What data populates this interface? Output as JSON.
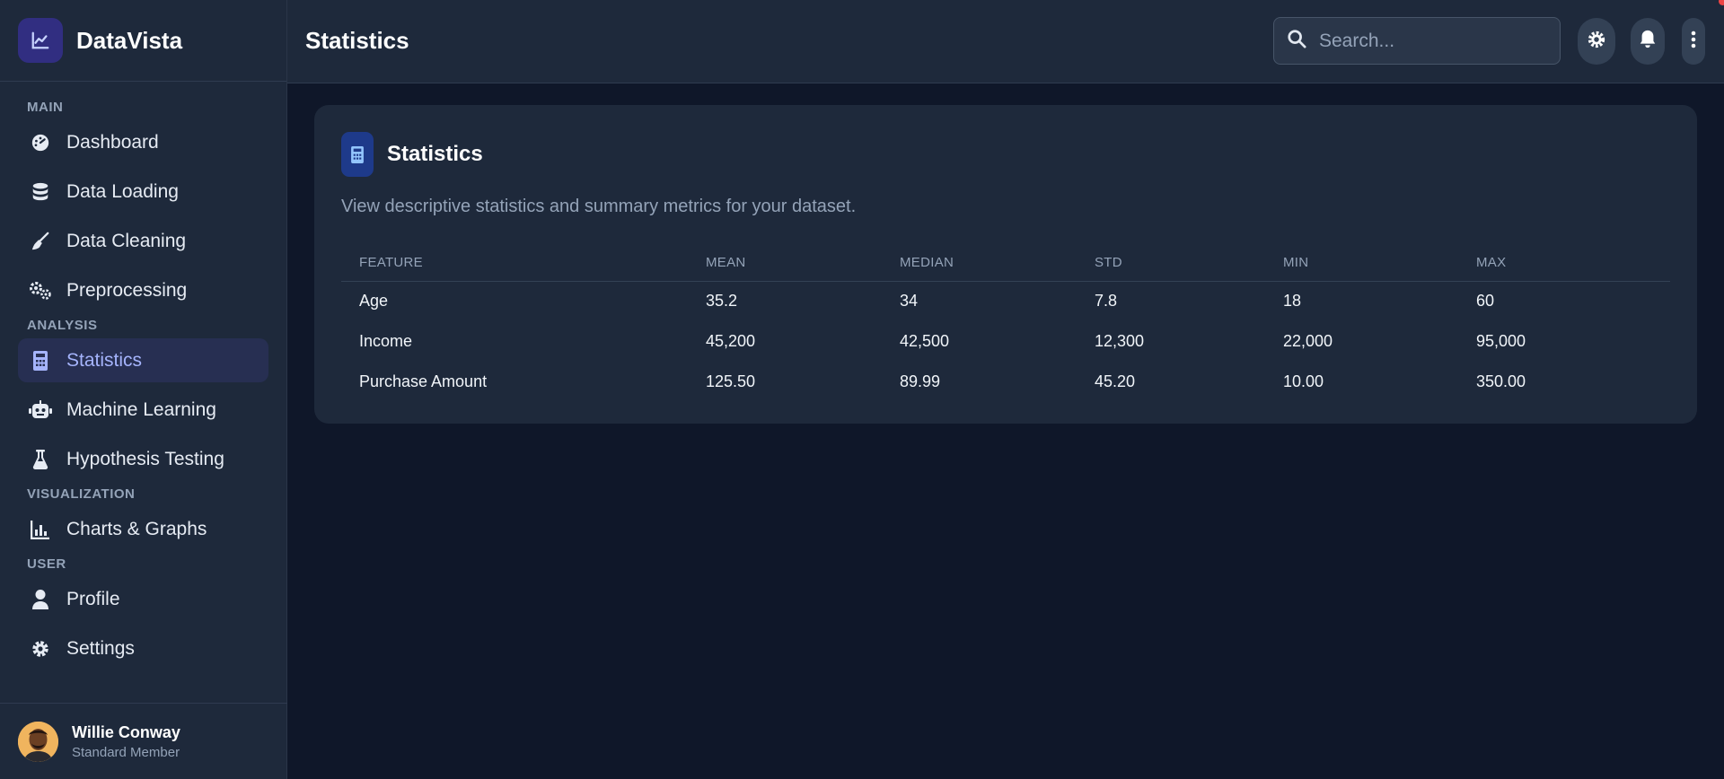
{
  "brand": {
    "name": "DataVista",
    "icon": "chart-line-icon",
    "accent": "#312e81"
  },
  "sidebar": {
    "sections": [
      {
        "label": "MAIN",
        "items": [
          {
            "label": "Dashboard",
            "icon": "gauge-icon"
          },
          {
            "label": "Data Loading",
            "icon": "database-icon"
          },
          {
            "label": "Data Cleaning",
            "icon": "broom-icon"
          },
          {
            "label": "Preprocessing",
            "icon": "gears-icon"
          }
        ]
      },
      {
        "label": "ANALYSIS",
        "items": [
          {
            "label": "Statistics",
            "icon": "calculator-icon",
            "active": true
          },
          {
            "label": "Machine Learning",
            "icon": "robot-icon"
          },
          {
            "label": "Hypothesis Testing",
            "icon": "flask-icon"
          }
        ]
      },
      {
        "label": "VISUALIZATION",
        "items": [
          {
            "label": "Charts & Graphs",
            "icon": "bar-chart-icon"
          }
        ]
      },
      {
        "label": "USER",
        "items": [
          {
            "label": "Profile",
            "icon": "user-icon"
          },
          {
            "label": "Settings",
            "icon": "gear-icon"
          }
        ]
      }
    ],
    "user": {
      "name": "Willie Conway",
      "role": "Standard Member"
    }
  },
  "header": {
    "title": "Statistics",
    "search_placeholder": "Search...",
    "buttons": [
      "theme-toggle-icon",
      "bell-icon",
      "more-vertical-icon"
    ],
    "notification_dot_color": "#ef4444"
  },
  "card": {
    "title": "Statistics",
    "icon": "calculator-icon",
    "description": "View descriptive statistics and summary metrics for your dataset.",
    "table": {
      "columns": [
        "FEATURE",
        "MEAN",
        "MEDIAN",
        "STD",
        "MIN",
        "MAX"
      ],
      "rows": [
        [
          "Age",
          "35.2",
          "34",
          "7.8",
          "18",
          "60"
        ],
        [
          "Income",
          "45,200",
          "42,500",
          "12,300",
          "22,000",
          "95,000"
        ],
        [
          "Purchase Amount",
          "125.50",
          "89.99",
          "45.20",
          "10.00",
          "350.00"
        ]
      ]
    }
  },
  "colors": {
    "background": "#0f1729",
    "surface": "#1e293b",
    "active": "#a5b4fc"
  }
}
